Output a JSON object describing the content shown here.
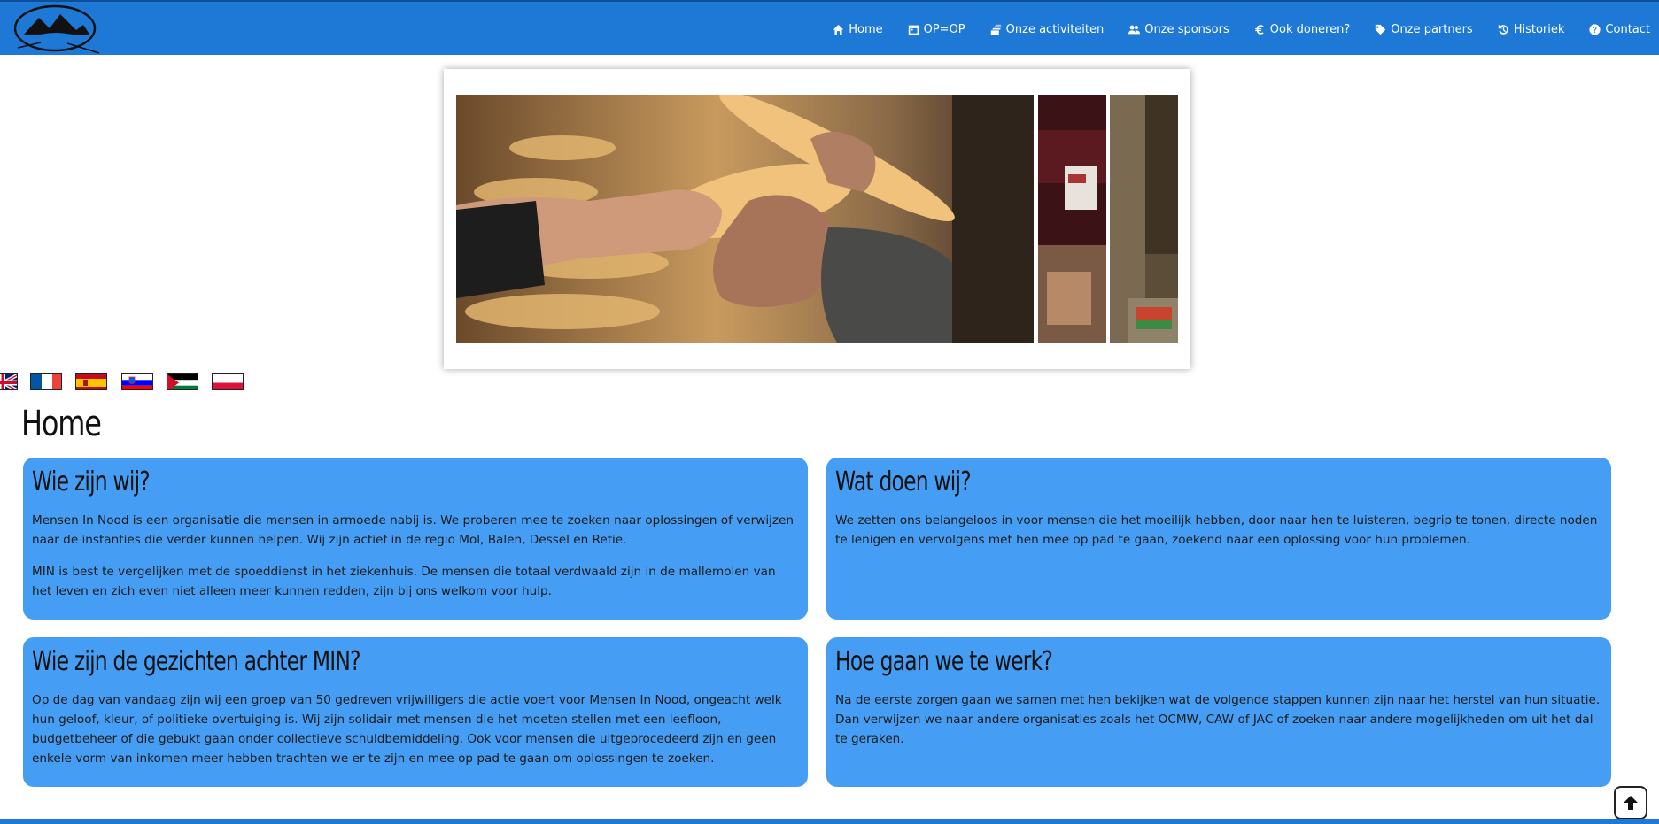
{
  "nav": {
    "items": [
      {
        "label": "Home",
        "icon": "home-icon"
      },
      {
        "label": "OP=OP",
        "icon": "calendar-icon"
      },
      {
        "label": "Onze activiteiten",
        "icon": "layers-icon"
      },
      {
        "label": "Onze sponsors",
        "icon": "users-icon"
      },
      {
        "label": "Ook doneren?",
        "icon": "euro-icon"
      },
      {
        "label": "Onze partners",
        "icon": "tag-icon"
      },
      {
        "label": "Historiek",
        "icon": "history-icon"
      },
      {
        "label": "Contact",
        "icon": "question-icon"
      }
    ]
  },
  "flags": [
    "english-flag",
    "french-flag",
    "spanish-flag",
    "slovenian-flag",
    "palestinian-flag",
    "polish-flag"
  ],
  "page": {
    "title": "Home"
  },
  "cards": {
    "wie": {
      "title": "Wie zijn wij?",
      "p1": "Mensen In Nood is een organisatie die mensen in armoede nabij is. We proberen mee te zoeken naar oplossingen of verwijzen naar de instanties die verder kunnen helpen. Wij zijn actief in de regio Mol, Balen, Dessel en Retie.",
      "p2": "MIN is best te vergelijken met de spoeddienst in het ziekenhuis. De mensen die totaal verdwaald zijn in de mallemolen van het leven en zich even niet alleen meer kunnen redden, zijn bij ons welkom voor hulp."
    },
    "wat": {
      "title": "Wat doen wij?",
      "p1": "We zetten ons belangeloos in voor mensen die het moeilijk hebben, door naar hen te luisteren, begrip te tonen, directe noden te lenigen en vervolgens met hen mee op pad te gaan, zoekend naar een oplossing voor hun problemen."
    },
    "gezichten": {
      "title": "Wie zijn de gezichten achter MIN?",
      "p1": "Op de dag van vandaag zijn wij een groep van 50 gedreven vrijwilligers die actie voert voor Mensen In Nood, ongeacht welk hun geloof, kleur, of politieke overtuiging is. Wij zijn solidair met mensen die het moeten stellen met een leefloon, budgetbeheer of die gebukt gaan onder collectieve schuldbemiddeling. Ook voor mensen die uitgeprocedeerd zijn en geen enkele vorm van inkomen meer hebben trachten we er te zijn en mee op pad te gaan om oplossingen te zoeken."
    },
    "werk": {
      "title": "Hoe gaan we te werk?",
      "p1": "Na de eerste zorgen gaan we samen met hen bekijken wat de volgende stappen kunnen zijn naar het herstel van hun situatie. Dan verwijzen we naar andere organisaties zoals het OCMW, CAW of JAC of zoeken naar andere mogelijkheden om uit het dal te geraken."
    }
  },
  "colors": {
    "nav": "#1e78d6",
    "card": "#459ef3"
  }
}
